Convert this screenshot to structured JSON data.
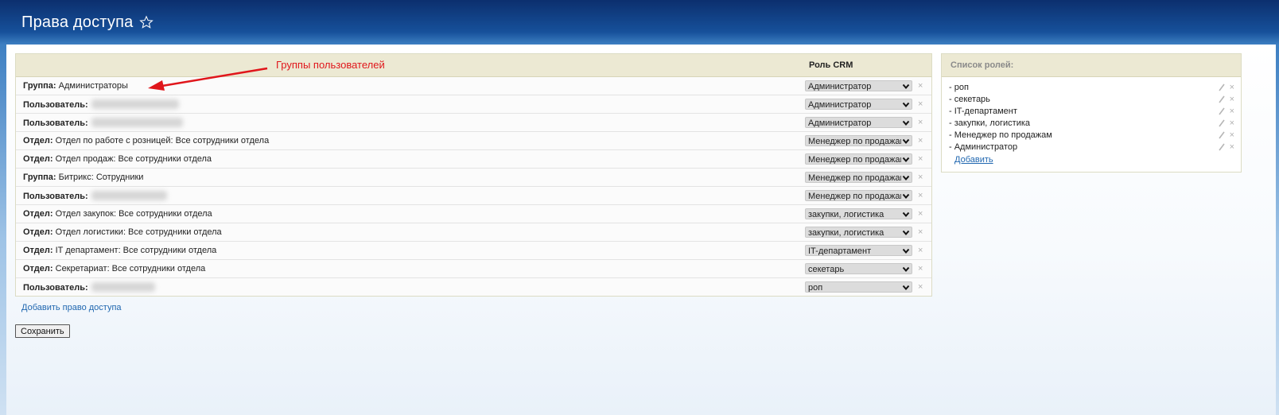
{
  "page": {
    "title": "Права доступа"
  },
  "table": {
    "role_column_header": "Роль CRM",
    "annotation": "Группы пользователей",
    "rows": [
      {
        "kind": "Группа:",
        "text": "Администраторы",
        "role": "Администратор"
      },
      {
        "kind": "Пользователь:",
        "text": "",
        "role": "Администратор"
      },
      {
        "kind": "Пользователь:",
        "text": "",
        "role": "Администратор"
      },
      {
        "kind": "Отдел:",
        "text": "Отдел по работе с розницей: Все сотрудники отдела",
        "role": "Менеджер по продажам"
      },
      {
        "kind": "Отдел:",
        "text": "Отдел продаж: Все сотрудники отдела",
        "role": "Менеджер по продажам"
      },
      {
        "kind": "Группа:",
        "text": "Битрикс: Сотрудники",
        "role": "Менеджер по продажам"
      },
      {
        "kind": "Пользователь:",
        "text": "",
        "role": "Менеджер по продажам"
      },
      {
        "kind": "Отдел:",
        "text": "Отдел закупок: Все сотрудники отдела",
        "role": "закупки, логистика"
      },
      {
        "kind": "Отдел:",
        "text": "Отдел логистики: Все сотрудники отдела",
        "role": "закупки, логистика"
      },
      {
        "kind": "Отдел:",
        "text": "IT департамент: Все сотрудники отдела",
        "role": "IT-департамент"
      },
      {
        "kind": "Отдел:",
        "text": "Секретариат: Все сотрудники отдела",
        "role": "секетарь"
      },
      {
        "kind": "Пользователь:",
        "text": "",
        "role": "роп"
      }
    ],
    "add_link": "Добавить право доступа",
    "save_button": "Сохранить"
  },
  "roles_panel": {
    "title": "Список ролей:",
    "roles": [
      "- роп",
      "- секетарь",
      "- IT-департамент",
      "- закупки, логистика",
      "- Менеджер по продажам",
      "- Администратор"
    ],
    "add_link": "Добавить"
  },
  "colors": {
    "annotation": "#e0161b",
    "link": "#2067b0",
    "header_bg": "#ece9d3"
  },
  "icons": {
    "title_star": "star-icon",
    "select_arrow": "chevron-down-icon",
    "row_delete": "close-icon",
    "role_edit": "pencil-icon",
    "role_delete": "close-icon"
  }
}
